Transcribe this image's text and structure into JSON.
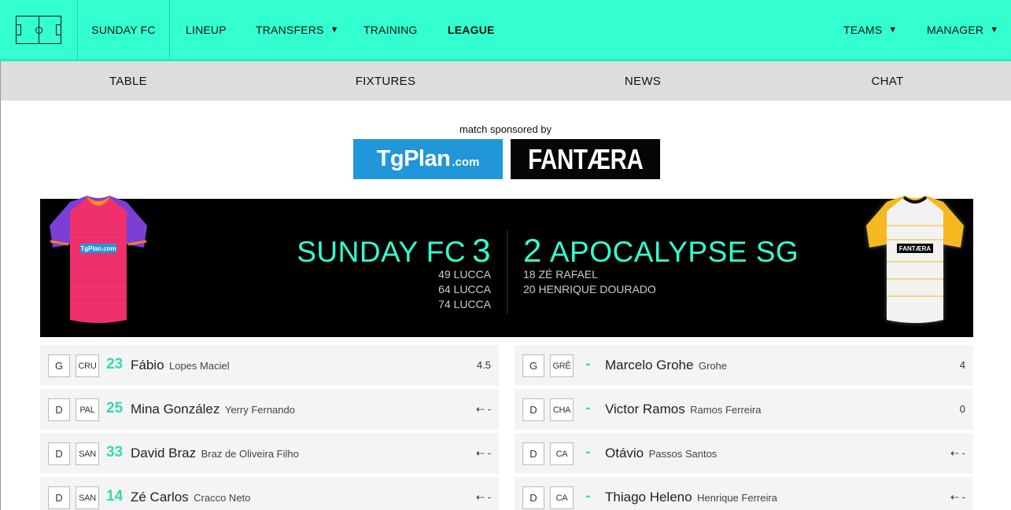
{
  "topnav": {
    "team": "SUNDAY FC",
    "items": [
      "LINEUP",
      "TRANSFERS",
      "TRAINING",
      "LEAGUE"
    ],
    "right_items": [
      "TEAMS",
      "MANAGER"
    ],
    "caret": "▼"
  },
  "subnav": [
    "TABLE",
    "FIXTURES",
    "NEWS",
    "CHAT"
  ],
  "sponsor": {
    "caption": "match sponsored by",
    "tgplan_main": "TgPlan",
    "tgplan_suffix": ".com",
    "fantaera": "FANTÆRA"
  },
  "match": {
    "home": {
      "name": "SUNDAY FC",
      "score": "3",
      "scorers": [
        "49 LUCCA",
        "64 LUCCA",
        "74 LUCCA"
      ],
      "shirt_sponsor": "TgPlan.com"
    },
    "away": {
      "name": "APOCALYPSE SG",
      "score": "2",
      "scorers": [
        "18 ZÉ RAFAEL",
        "20 HENRIQUE DOURADO"
      ],
      "shirt_sponsor": "FANTÆRA"
    }
  },
  "home_lineup": [
    {
      "pos": "G",
      "club": "CRU",
      "number": "23",
      "name": "Fábio",
      "full": "Lopes Maciel",
      "points": "4.5"
    },
    {
      "pos": "D",
      "club": "PAL",
      "number": "25",
      "name": "Mina González",
      "full": "Yerry Fernando",
      "points": "⇠ -"
    },
    {
      "pos": "D",
      "club": "SAN",
      "number": "33",
      "name": "David Braz",
      "full": "Braz de Oliveira Filho",
      "points": "⇠ -"
    },
    {
      "pos": "D",
      "club": "SAN",
      "number": "14",
      "name": "Zé Carlos",
      "full": "Cracco Neto",
      "points": "⇠ -"
    }
  ],
  "away_lineup": [
    {
      "pos": "G",
      "club": "GRÊ",
      "number": "-",
      "name": "Marcelo Grohe",
      "full": "Grohe",
      "points": "4"
    },
    {
      "pos": "D",
      "club": "CHA",
      "number": "-",
      "name": "Victor Ramos",
      "full": "Ramos Ferreira",
      "points": "0"
    },
    {
      "pos": "D",
      "club": "CA",
      "number": "-",
      "name": "Otávio",
      "full": "Passos Santos",
      "points": "⇠ -"
    },
    {
      "pos": "D",
      "club": "CA",
      "number": "-",
      "name": "Thiago Heleno",
      "full": "Henrique Ferreira",
      "points": "⇠ -"
    }
  ],
  "colors": {
    "accent": "#33ffd0",
    "home_shirt": "#f0306a",
    "home_sleeves": "#7b3fd6",
    "away_shirt": "#f2f2f2",
    "away_sleeves": "#f5b81f"
  }
}
